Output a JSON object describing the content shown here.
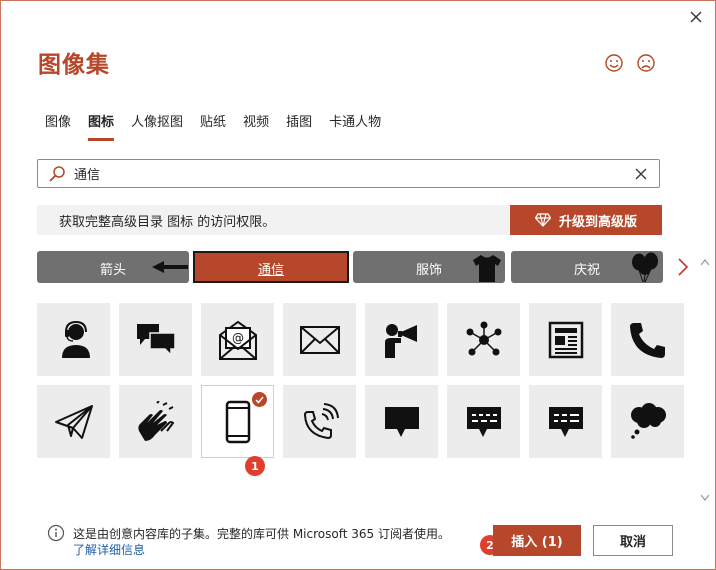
{
  "dialog": {
    "title": "图像集",
    "close_icon": "close-icon",
    "feedback_icons": [
      "smile-icon",
      "frown-icon"
    ]
  },
  "tabs": [
    {
      "label": "图像",
      "active": false
    },
    {
      "label": "图标",
      "active": true
    },
    {
      "label": "人像抠图",
      "active": false
    },
    {
      "label": "贴纸",
      "active": false
    },
    {
      "label": "视频",
      "active": false
    },
    {
      "label": "插图",
      "active": false
    },
    {
      "label": "卡通人物",
      "active": false
    }
  ],
  "search": {
    "value": "通信",
    "icon": "search-icon",
    "clear_icon": "close-icon"
  },
  "promo": {
    "text": "获取完整高级目录 图标 的访问权限。",
    "upgrade_label": "升级到高级版",
    "upgrade_icon": "diamond-icon"
  },
  "categories": [
    {
      "label": "箭头",
      "icon": "arrow-left-icon",
      "active": false
    },
    {
      "label": "通信",
      "icon": "",
      "active": true
    },
    {
      "label": "服饰",
      "icon": "tshirt-icon",
      "active": false
    },
    {
      "label": "庆祝",
      "icon": "balloons-icon",
      "active": false
    }
  ],
  "categories_next_icon": "chevron-right-icon",
  "icons": [
    {
      "name": "headset-user-icon",
      "selected": false
    },
    {
      "name": "chat-bubbles-icon",
      "selected": false
    },
    {
      "name": "email-envelope-icon",
      "selected": false
    },
    {
      "name": "envelope-icon",
      "selected": false
    },
    {
      "name": "megaphone-person-icon",
      "selected": false
    },
    {
      "name": "network-icon",
      "selected": false
    },
    {
      "name": "newspaper-icon",
      "selected": false
    },
    {
      "name": "phone-handset-icon",
      "selected": false
    },
    {
      "name": "paper-plane-icon",
      "selected": false
    },
    {
      "name": "sign-language-icon",
      "selected": false
    },
    {
      "name": "smartphone-icon",
      "selected": true
    },
    {
      "name": "phone-ringing-icon",
      "selected": false
    },
    {
      "name": "speech-bubble-icon",
      "selected": false
    },
    {
      "name": "typing-bubble-icon",
      "selected": false
    },
    {
      "name": "typing-bubble-2-icon",
      "selected": false
    },
    {
      "name": "thought-bubble-icon",
      "selected": false
    }
  ],
  "badges": {
    "first": "1",
    "second": "2"
  },
  "footer": {
    "info_text": "这是由创意内容库的子集。完整的库可供 Microsoft 365 订阅者使用。",
    "learn_more": "了解详细信息",
    "insert_label": "插入 (1)",
    "cancel_label": "取消"
  },
  "colors": {
    "accent": "#b7472a",
    "category_bg": "#707070",
    "badge": "#e03f2f"
  }
}
